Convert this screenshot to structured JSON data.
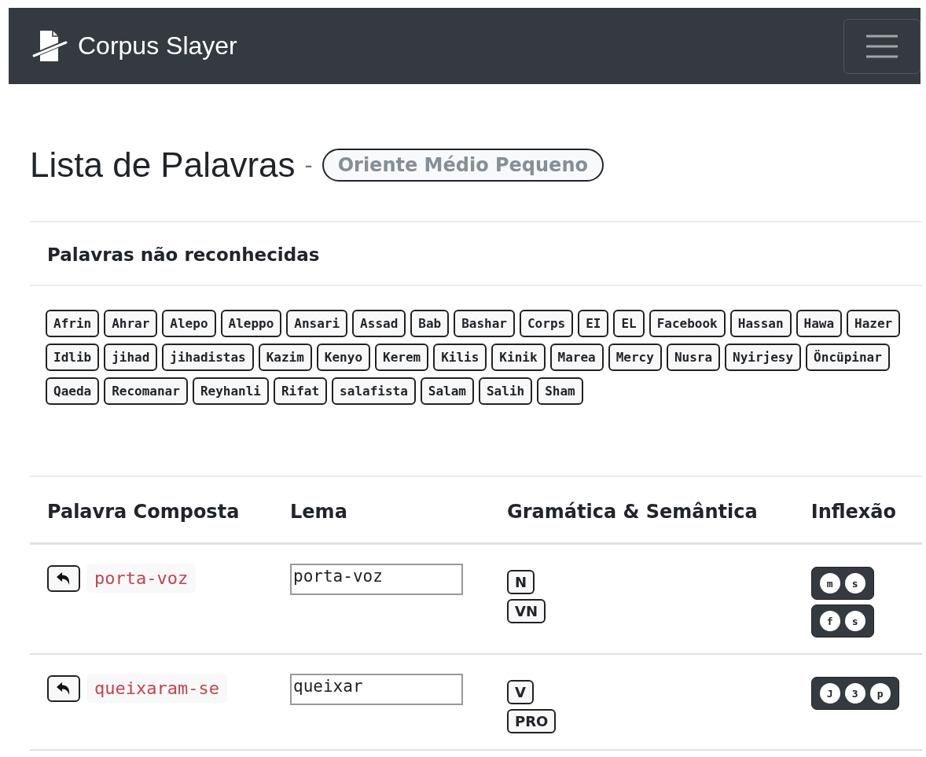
{
  "navbar": {
    "brand": "Corpus Slayer"
  },
  "page": {
    "title": "Lista de Palavras",
    "separator": "-",
    "corpus": "Oriente Médio Pequeno"
  },
  "unrecognized": {
    "heading": "Palavras não reconhecidas",
    "words": [
      "Afrin",
      "Ahrar",
      "Alepo",
      "Aleppo",
      "Ansari",
      "Assad",
      "Bab",
      "Bashar",
      "Corps",
      "EI",
      "EL",
      "Facebook",
      "Hassan",
      "Hawa",
      "Hazer",
      "Idlib",
      "jihad",
      "jihadistas",
      "Kazim",
      "Kenyo",
      "Kerem",
      "Kilis",
      "Kinik",
      "Marea",
      "Mercy",
      "Nusra",
      "Nyirjesy",
      "Öncüpinar",
      "Qaeda",
      "Recomanar",
      "Reyhanli",
      "Rifat",
      "salafista",
      "Salam",
      "Salih",
      "Sham"
    ]
  },
  "table": {
    "columns": [
      "Palavra Composta",
      "Lema",
      "Gramática & Semântica",
      "Inflexão"
    ],
    "rows": [
      {
        "word": "porta-voz",
        "lemma": "porta-voz",
        "tags": [
          "N",
          "VN"
        ],
        "inflections": [
          [
            "m",
            "s"
          ],
          [
            "f",
            "s"
          ]
        ]
      },
      {
        "word": "queixaram-se",
        "lemma": "queixar",
        "tags": [
          "V",
          "PRO"
        ],
        "inflections": [
          [
            "J",
            "3",
            "p"
          ]
        ]
      }
    ]
  }
}
